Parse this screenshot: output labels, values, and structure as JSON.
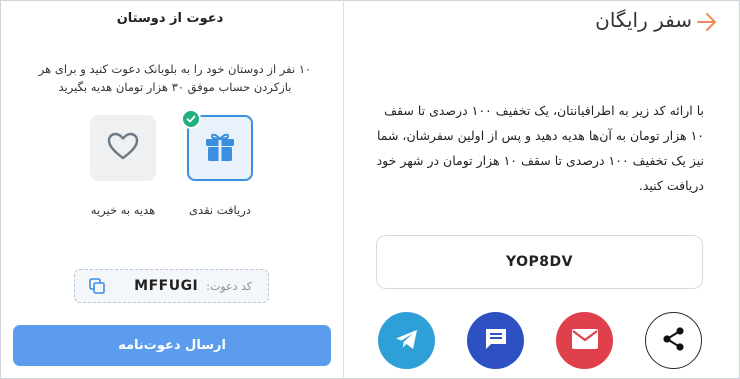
{
  "right_panel": {
    "title": "سفر رایگان",
    "description": "با ارائه کد زیر به اطرافیانتان، یک تخفیف ۱۰۰ درصدی تا سقف ۱۰ هزار تومان به آن‌ها هدیه دهید و پس از اولین سفرشان، شما نیز یک تخفیف ۱۰۰ درصدی تا سقف ۱۰ هزار تومان در شهر خود دریافت کنید.",
    "code": "YOP8DV",
    "share_icons": [
      "telegram-icon",
      "sms-icon",
      "mail-icon",
      "share-icon"
    ],
    "colors": {
      "telegram": "#2f9fd8",
      "sms": "#2d51c2",
      "mail": "#e0404b",
      "back_arrow": "#f08a5d"
    }
  },
  "left_panel": {
    "title": "دعوت از دوستان",
    "description": "۱۰ نفر از دوستان خود را به بلوبانک دعوت کنید و برای هر بازکردن حساب موفق ۳۰ هزار تومان هدیه بگیرید",
    "options": [
      {
        "label": "دریافت نقدی",
        "icon": "gift-icon",
        "selected": true
      },
      {
        "label": "هدیه به خیریه",
        "icon": "heart-icon",
        "selected": false
      }
    ],
    "invite_label": "کد دعوت:",
    "invite_code": "MFFUGI",
    "send_button": "ارسال دعوت‌نامه",
    "colors": {
      "accent": "#3b8fe0",
      "button": "#5b9cef",
      "check": "#22b07d"
    }
  }
}
